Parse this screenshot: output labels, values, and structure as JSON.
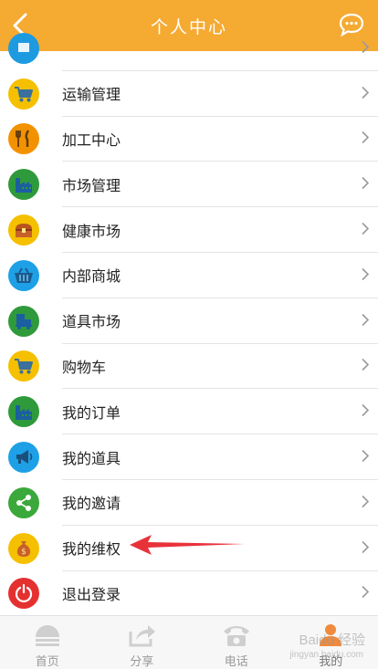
{
  "header": {
    "title": "个人中心",
    "back_icon": "back-arrow-icon",
    "chat_icon": "chat-bubble-icon"
  },
  "menu": [
    {
      "label": "",
      "icon": "partial-icon",
      "color": "#1e9ae0"
    },
    {
      "label": "运输管理",
      "icon": "cart-icon",
      "color": "#f5c000"
    },
    {
      "label": "加工中心",
      "icon": "fork-knife-icon",
      "color": "#f39200"
    },
    {
      "label": "市场管理",
      "icon": "factory-icon",
      "color": "#2f9a3b"
    },
    {
      "label": "健康市场",
      "icon": "treasure-box-icon",
      "color": "#f5c000"
    },
    {
      "label": "内部商城",
      "icon": "basket-icon",
      "color": "#1ea0e6"
    },
    {
      "label": "道具市场",
      "icon": "truck-icon",
      "color": "#2f9a3b"
    },
    {
      "label": "购物车",
      "icon": "cart-icon",
      "color": "#f5c000"
    },
    {
      "label": "我的订单",
      "icon": "factory-icon",
      "color": "#2f9a3b"
    },
    {
      "label": "我的道具",
      "icon": "megaphone-icon",
      "color": "#1ea0e6"
    },
    {
      "label": "我的邀请",
      "icon": "share-icon",
      "color": "#3aa83a"
    },
    {
      "label": "我的维权",
      "icon": "money-bag-icon",
      "color": "#f5c000"
    },
    {
      "label": "退出登录",
      "icon": "power-icon",
      "color": "#e53030"
    }
  ],
  "tabs": [
    {
      "label": "首页",
      "icon": "home-icon"
    },
    {
      "label": "分享",
      "icon": "share-arrow-icon"
    },
    {
      "label": "电话",
      "icon": "phone-icon"
    },
    {
      "label": "我的",
      "icon": "person-icon"
    }
  ],
  "watermark": {
    "line1": "Baidu 经验",
    "line2": "jingyan.baidu.com"
  },
  "colors": {
    "header_bg": "#f5aa32",
    "annotation_arrow": "#e8323a"
  }
}
